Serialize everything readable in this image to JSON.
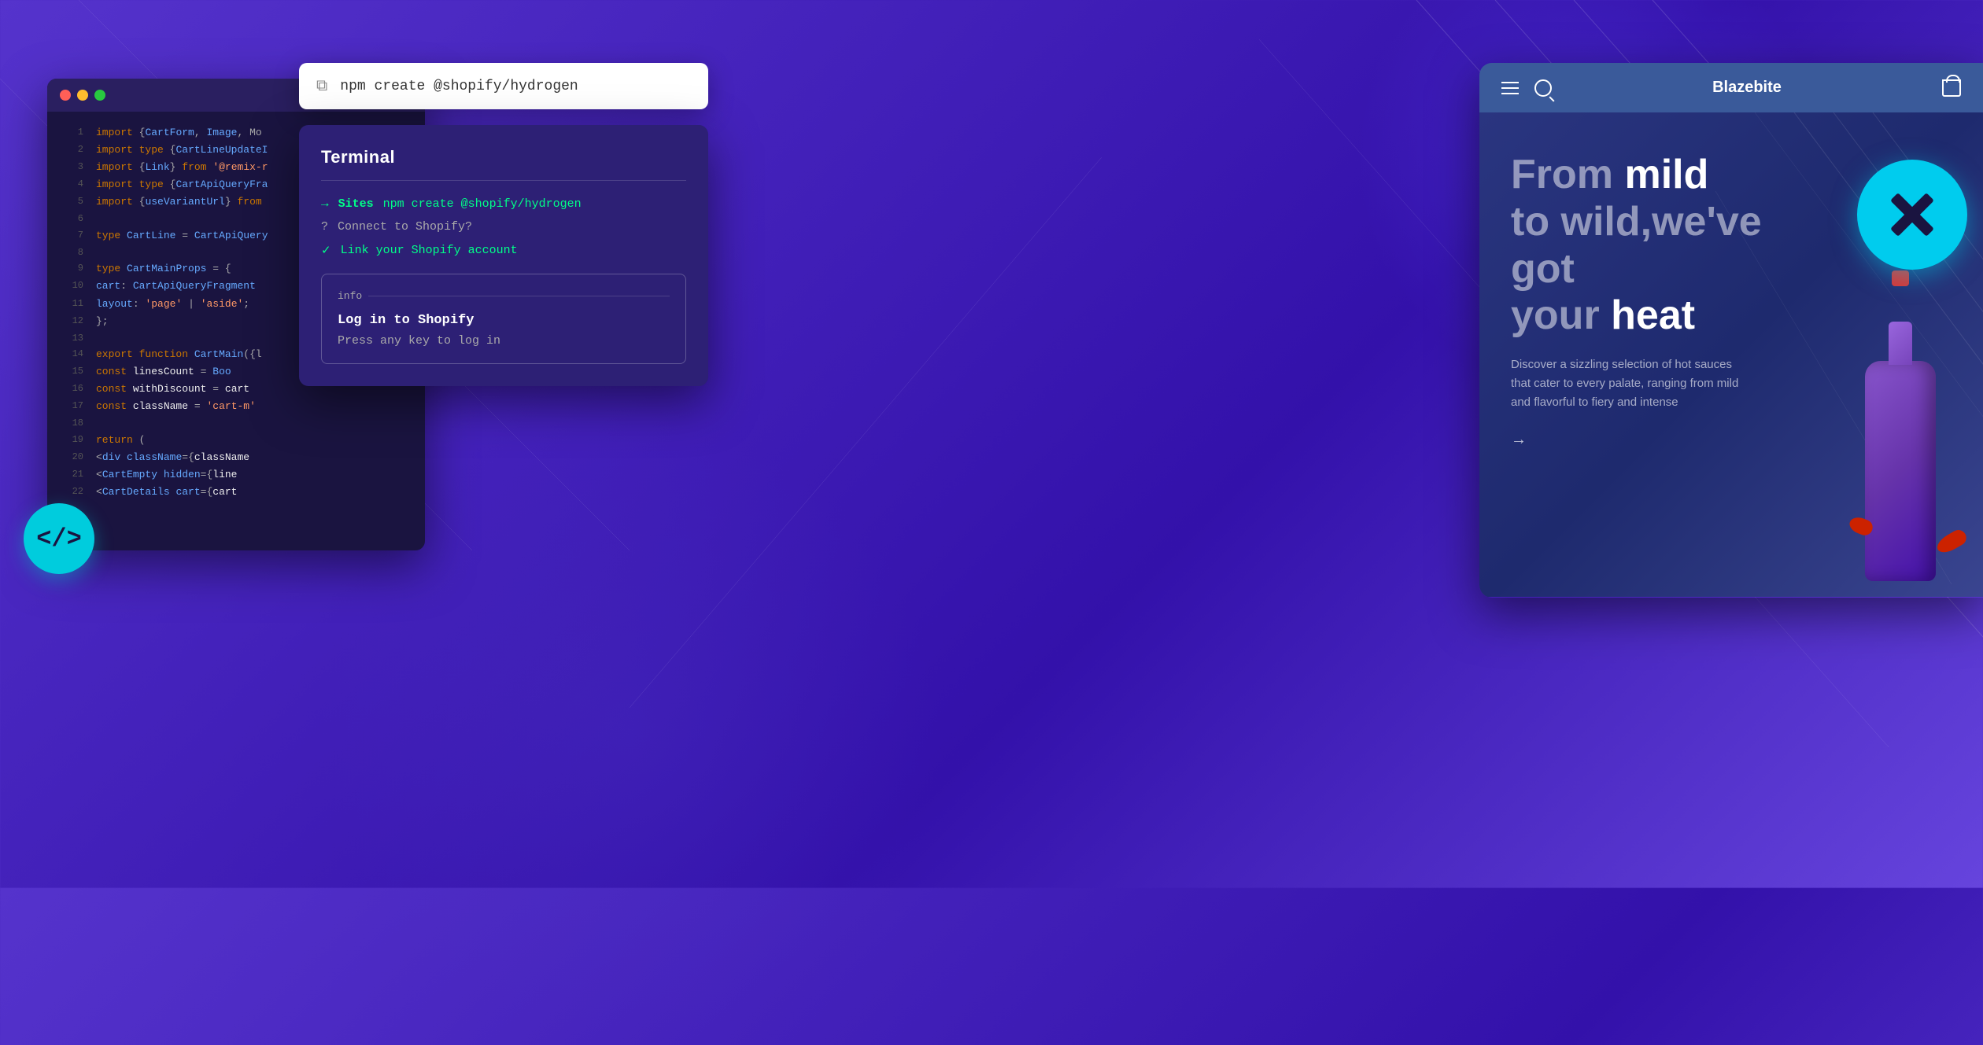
{
  "background": {
    "gradient_start": "#5533cc",
    "gradient_end": "#4422bb"
  },
  "command_bar": {
    "command": "npm create @shopify/hydrogen",
    "copy_icon": "⧉"
  },
  "terminal": {
    "title": "Terminal",
    "lines": [
      {
        "type": "command",
        "prefix": "→",
        "site_label": "Sites",
        "text": "npm create @shopify/hydrogen"
      },
      {
        "type": "question",
        "prefix": "?",
        "text": "Connect to Shopify?"
      },
      {
        "type": "answer",
        "prefix": "✓",
        "text": "Link your Shopify account"
      }
    ],
    "info_box": {
      "label": "info",
      "title": "Log in to Shopify",
      "subtitle": "Press any key to log in"
    }
  },
  "code_editor": {
    "lines": [
      {
        "number": 1,
        "text": "import {CartForm, Image, Mo"
      },
      {
        "number": 2,
        "text": "import type {CartLineUpdateI"
      },
      {
        "number": 3,
        "text": "import {Link} from '@remix-r"
      },
      {
        "number": 4,
        "text": "import type {CartApiQueryFra"
      },
      {
        "number": 5,
        "text": "import {useVariantUrl} from"
      },
      {
        "number": 6,
        "text": ""
      },
      {
        "number": 7,
        "text": "type CartLine = CartApiQuery"
      },
      {
        "number": 8,
        "text": ""
      },
      {
        "number": 9,
        "text": "type CartMainProps = {"
      },
      {
        "number": 10,
        "text": "  cart: CartApiQueryFragment"
      },
      {
        "number": 11,
        "text": "  layout: 'page' | 'aside';"
      },
      {
        "number": 12,
        "text": "};"
      },
      {
        "number": 13,
        "text": ""
      },
      {
        "number": 14,
        "text": "export function CartMain({l"
      },
      {
        "number": 15,
        "text": "  const linesCount = Boo"
      },
      {
        "number": 16,
        "text": "  const withDiscount = cart"
      },
      {
        "number": 17,
        "text": "  const className = 'cart-m'"
      },
      {
        "number": 18,
        "text": ""
      },
      {
        "number": 19,
        "text": "  return ("
      },
      {
        "number": 20,
        "text": "    <div className={className"
      },
      {
        "number": 21,
        "text": "      <CartEmpty hidden={line"
      },
      {
        "number": 22,
        "text": "      <CartDetails cart={cart"
      }
    ],
    "badge": {
      "icon": "</>"
    }
  },
  "storefront": {
    "nav": {
      "store_name": "Blazebite",
      "aria_hamburger": "menu",
      "aria_search": "search",
      "aria_cart": "cart"
    },
    "hero": {
      "headline_part1": "From ",
      "headline_highlight1": "mild",
      "headline_part2": " to wild,we've got your ",
      "headline_highlight2": "heat",
      "description": "Discover a sizzling selection of hot sauces that cater to every palate, ranging from mild and flavorful to fiery and intense",
      "cta_arrow": "→"
    },
    "brand": {
      "name": "Blazebite"
    }
  }
}
